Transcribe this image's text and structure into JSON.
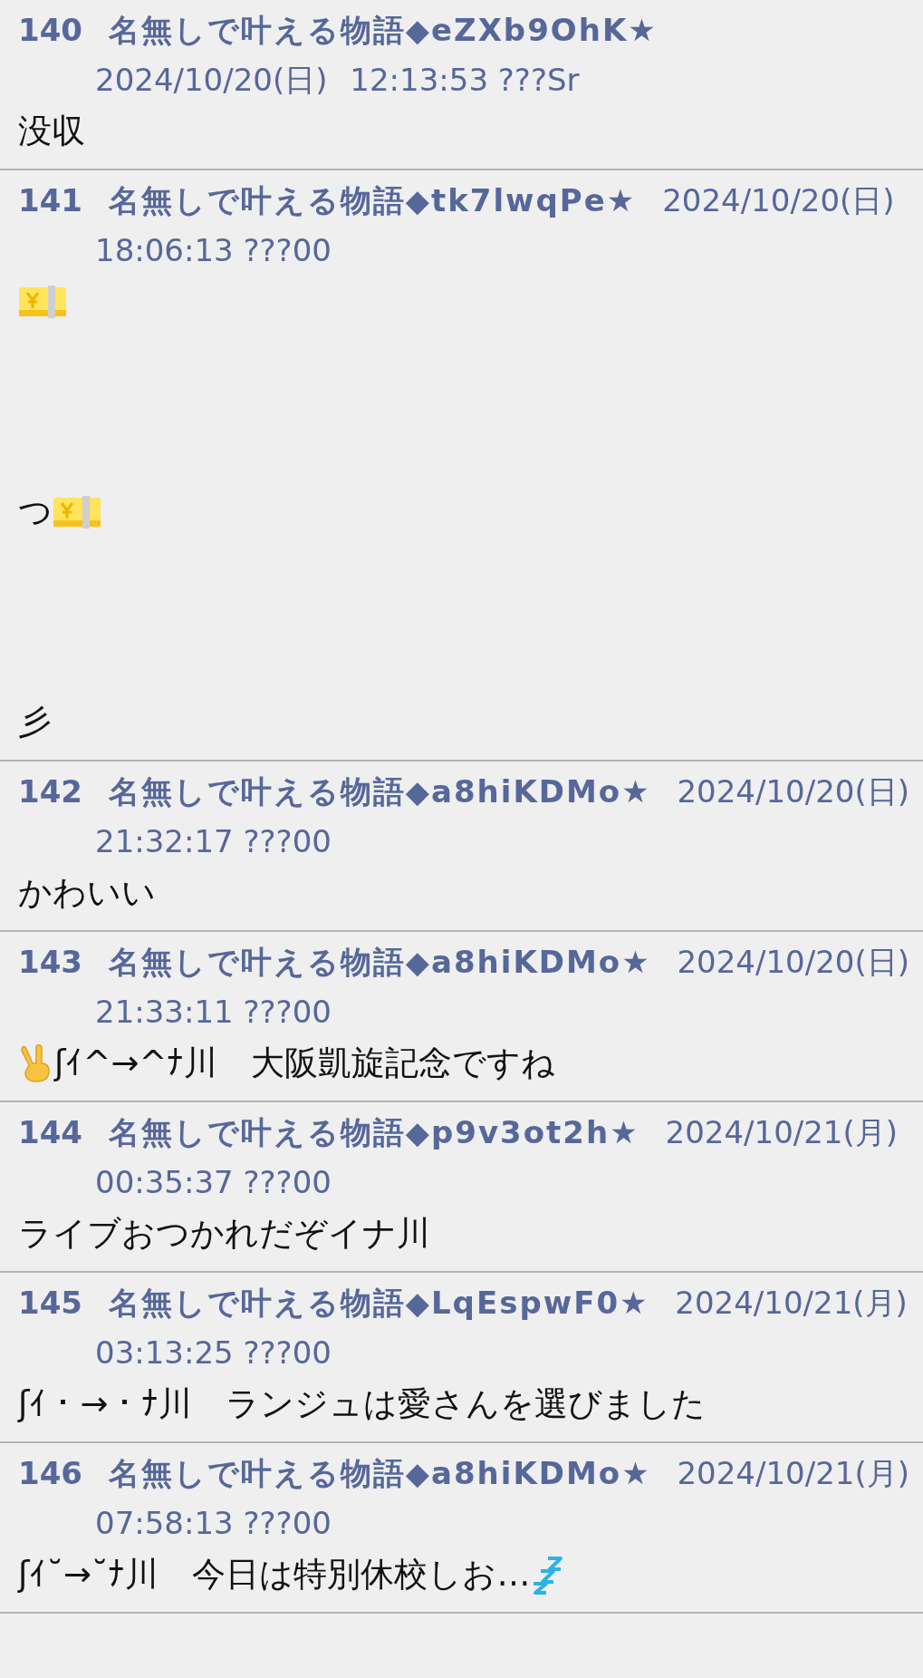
{
  "posts": [
    {
      "number": "140",
      "name": "名無しで叶える物語◆eZXb9OhK★",
      "date": "2024/10/20(日)",
      "time": "12:13:53 ???Sr",
      "body": [
        {
          "kind": "line",
          "segments": [
            {
              "kind": "text",
              "text": "没収"
            }
          ]
        }
      ]
    },
    {
      "number": "141",
      "name": "名無しで叶える物語◆tk7lwqPe★",
      "date": "2024/10/20(日)",
      "time": "18:06:13 ???00",
      "body": [
        {
          "kind": "line",
          "segments": [
            {
              "kind": "yen-bills"
            }
          ]
        },
        {
          "kind": "blank"
        },
        {
          "kind": "blank"
        },
        {
          "kind": "blank"
        },
        {
          "kind": "line",
          "segments": [
            {
              "kind": "text",
              "text": "つ"
            },
            {
              "kind": "yen-bills"
            }
          ]
        },
        {
          "kind": "blank"
        },
        {
          "kind": "blank"
        },
        {
          "kind": "blank"
        },
        {
          "kind": "line",
          "segments": [
            {
              "kind": "text",
              "text": "彡"
            }
          ]
        }
      ]
    },
    {
      "number": "142",
      "name": "名無しで叶える物語◆a8hiKDMo★",
      "date": "2024/10/20(日)",
      "time": "21:32:17 ???00",
      "body": [
        {
          "kind": "line",
          "segments": [
            {
              "kind": "text",
              "text": "かわいい"
            }
          ]
        }
      ]
    },
    {
      "number": "143",
      "name": "名無しで叶える物語◆a8hiKDMo★",
      "date": "2024/10/20(日)",
      "time": "21:33:11 ???00",
      "body": [
        {
          "kind": "line",
          "segments": [
            {
              "kind": "victory-hand"
            },
            {
              "kind": "text",
              "text": "ʃｲ^→^ﾅ川　大阪凱旋記念ですね"
            }
          ]
        }
      ]
    },
    {
      "number": "144",
      "name": "名無しで叶える物語◆p9v3ot2h★",
      "date": "2024/10/21(月)",
      "time": "00:35:37 ???00",
      "body": [
        {
          "kind": "line",
          "segments": [
            {
              "kind": "text",
              "text": "ライブおつかれだぞイナ川"
            }
          ]
        }
      ]
    },
    {
      "number": "145",
      "name": "名無しで叶える物語◆LqEspwF0★",
      "date": "2024/10/21(月)",
      "time": "03:13:25 ???00",
      "body": [
        {
          "kind": "line",
          "segments": [
            {
              "kind": "text",
              "text": "ʃｲ・→・ﾅ川　ランジュは愛さんを選びました"
            }
          ]
        }
      ]
    },
    {
      "number": "146",
      "name": "名無しで叶える物語◆a8hiKDMo★",
      "date": "2024/10/21(月)",
      "time": "07:58:13 ???00",
      "body": [
        {
          "kind": "line",
          "segments": [
            {
              "kind": "text",
              "text": "ʃｲ˘→˘ﾅ川　今日は特別休校しお…"
            },
            {
              "kind": "sleep-zzz"
            }
          ]
        }
      ]
    }
  ]
}
